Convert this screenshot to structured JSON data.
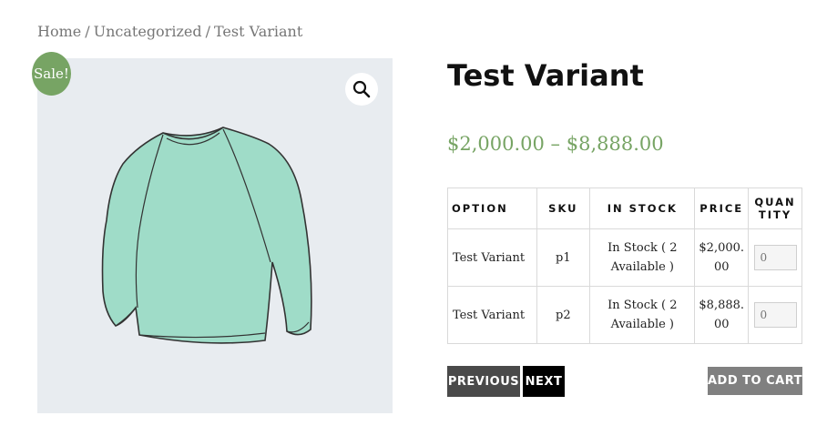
{
  "breadcrumb": {
    "home": "Home",
    "category": "Uncategorized",
    "current": "Test Variant",
    "separator": "/"
  },
  "gallery": {
    "sale_badge": "Sale!",
    "zoom_icon": "search-icon",
    "image_alt": "sweater"
  },
  "product": {
    "title": "Test Variant",
    "price_range": "$2,000.00 – $8,888.00",
    "price_color": "#77a464"
  },
  "variants_table": {
    "headers": {
      "option": "OPTION",
      "sku": "SKU",
      "in_stock": "IN STOCK",
      "price": "PRICE",
      "quantity_line1": "QUAN",
      "quantity_line2": "TITY"
    },
    "rows": [
      {
        "option": "Test Variant",
        "sku": "p1",
        "stock_line1": "In Stock ( 2",
        "stock_line2": "Available )",
        "price_line1": "$2,000.",
        "price_line2": "00",
        "qty_placeholder": "0"
      },
      {
        "option": "Test Variant",
        "sku": "p2",
        "stock_line1": "In Stock ( 2",
        "stock_line2": "Available )",
        "price_line1": "$8,888.",
        "price_line2": "00",
        "qty_placeholder": "0"
      }
    ]
  },
  "buttons": {
    "previous": "PREVIOUS",
    "next": "NEXT",
    "add_to_cart": "ADD TO CART"
  }
}
